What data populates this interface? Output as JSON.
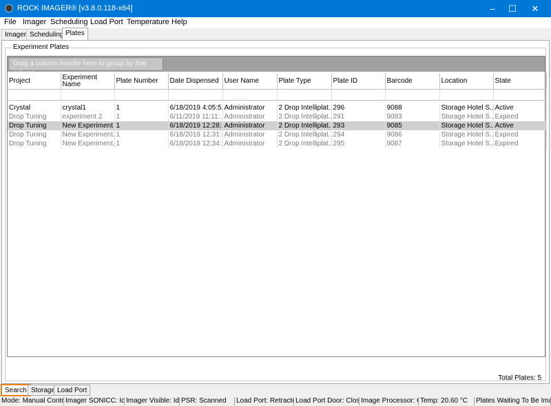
{
  "window": {
    "title": "ROCK IMAGER® [v3.8.0.118-x64]",
    "min": "–",
    "max": "☐",
    "close": "✕"
  },
  "menu": [
    "File",
    "Imager",
    "Scheduling",
    "Load Port",
    "Temperature",
    "Help"
  ],
  "top_tabs": {
    "imager": "Imager",
    "scheduling": "Scheduling",
    "plates": "Plates",
    "active": "Plates"
  },
  "group_title": "Experiment Plates",
  "group_hint": "Drag a column header here to group by that column.",
  "columns": [
    "Project",
    "Experiment Name",
    "Plate Number",
    "Date Dispensed",
    "User Name",
    "Plate Type",
    "Plate ID",
    "Barcode",
    "Location",
    "State"
  ],
  "rows": [
    [
      "Crystal",
      "crystal1",
      "1",
      "6/18/2019  4:05:5...",
      "Administrator",
      "2 Drop Intelliplat...",
      "296",
      "9088",
      "Storage Hotel S...",
      "Active"
    ],
    [
      "Drop Tuning",
      "experiment 2",
      "1",
      "6/11/2019  11:11:...",
      "Administrator",
      "2 Drop Intelliplat...",
      "291",
      "9083",
      "Storage Hotel S...",
      "Expired"
    ],
    [
      "Drop Tuning",
      "New Experiment",
      "1",
      "6/18/2019  12:28:...",
      "Administrator",
      "2 Drop Intelliplat...",
      "293",
      "9085",
      "Storage Hotel S...",
      "Active"
    ],
    [
      "Drop Tuning",
      "New Experiment...",
      "1",
      "6/18/2019  12:31:...",
      "Administrator",
      "2 Drop Intelliplat...",
      "294",
      "9086",
      "Storage Hotel S...",
      "Expired"
    ],
    [
      "Drop Tuning",
      "New Experiment...",
      "1",
      "6/18/2019  12:34:...",
      "Administrator",
      "2 Drop Intelliplat...",
      "295",
      "9087",
      "Storage Hotel S...",
      "Expired"
    ]
  ],
  "selected_row": 2,
  "total_plates": "Total Plates:  5",
  "bottom_tabs": {
    "search": "Search",
    "storage": "Storage",
    "load_port": "Load Port",
    "active": "Search"
  },
  "status": [
    "Mode: Manual Control",
    "Imager SONICC: Idle",
    "Imager Visible: Idle",
    "PSR: Scanned",
    "Load Port: Retracted",
    "Load Port Door: Closed",
    "Image Processor: On",
    "Temp: 20.60 °C",
    "Plates Waiting To Be Imaged"
  ],
  "colors": {
    "titlebar": "#0078d7",
    "selected_row": "#d0d0d0",
    "active_bottom_tab_outline": "#f08018",
    "expired_text": "#7a7a7a"
  }
}
